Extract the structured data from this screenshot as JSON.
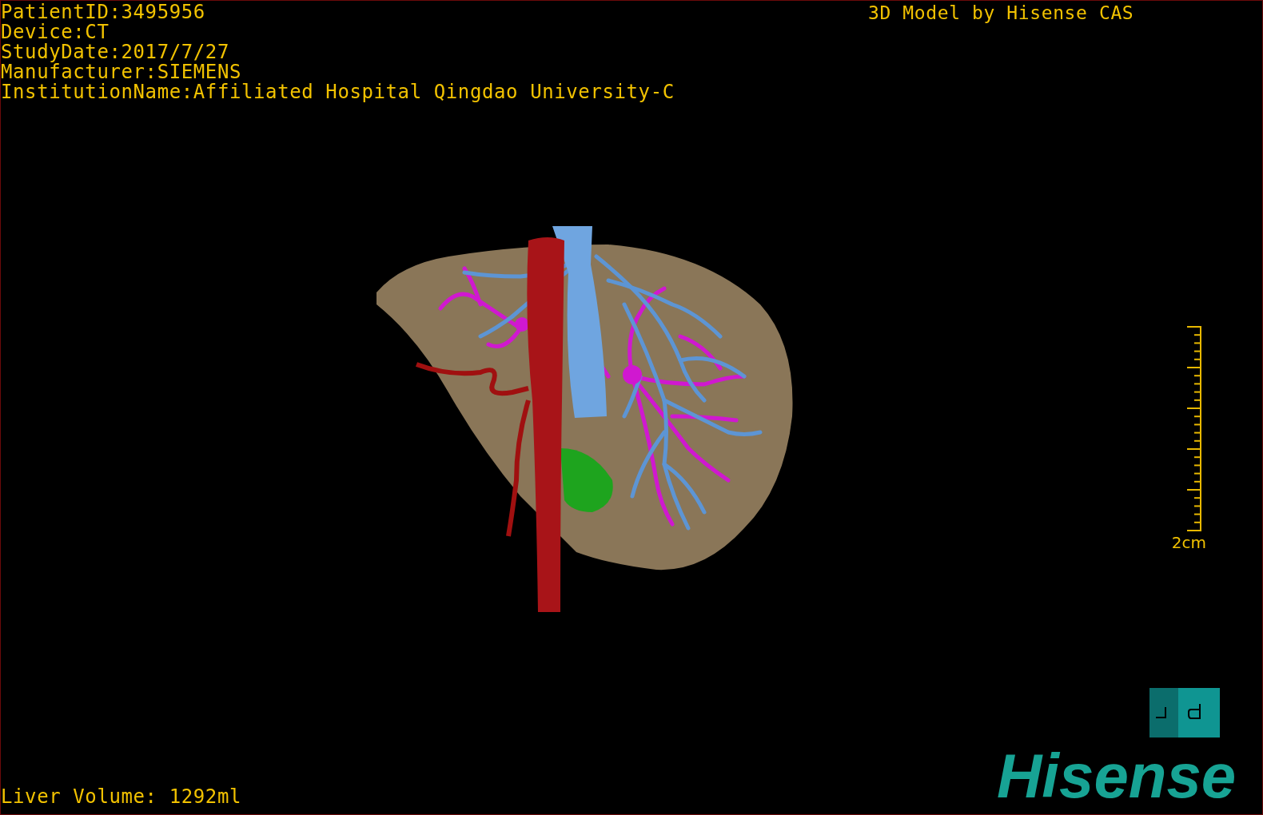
{
  "info_lines": [
    "PatientID:3495956",
    "Device:CT",
    "StudyDate:2017/7/27",
    "Manufacturer:SIEMENS",
    "InstitutionName:Affiliated Hospital Qingdao University-C"
  ],
  "model_credit": "3D Model by Hisense CAS",
  "scale_bar": {
    "label": "2cm"
  },
  "liver_volume": "Liver Volume: 1292ml",
  "logo": "Hisense"
}
